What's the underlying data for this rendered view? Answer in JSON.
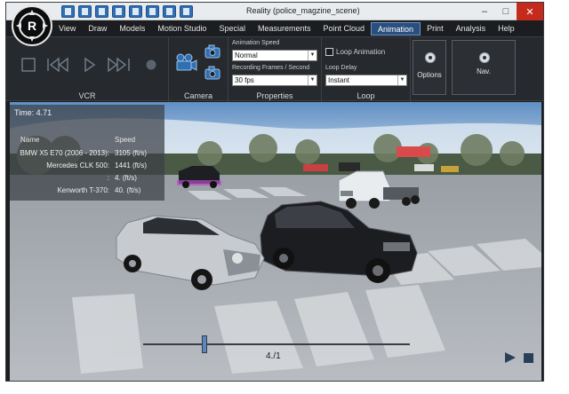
{
  "window": {
    "title": "Reality (police_magzine_scene)",
    "controls": {
      "minimize": "–",
      "maximize": "□",
      "close": "✕"
    }
  },
  "quick_access": [
    "new-file-icon",
    "open-folder-icon",
    "save-icon",
    "save-as-icon",
    "copy-icon",
    "paste-icon",
    "image-icon",
    "link-icon"
  ],
  "menu": {
    "items": [
      {
        "label": "View"
      },
      {
        "label": "Draw"
      },
      {
        "label": "Models"
      },
      {
        "label": "Motion Studio"
      },
      {
        "label": "Special"
      },
      {
        "label": "Measurements"
      },
      {
        "label": "Point Cloud"
      },
      {
        "label": "Animation",
        "active": true
      },
      {
        "label": "Print"
      },
      {
        "label": "Analysis"
      },
      {
        "label": "Help"
      }
    ]
  },
  "ribbon": {
    "vcr": {
      "label": "VCR",
      "buttons": [
        "stop-square-icon",
        "rewind-icon",
        "play-icon",
        "fast-forward-icon",
        "record-icon"
      ]
    },
    "camera": {
      "label": "Camera",
      "icons": [
        "movie-camera-icon",
        "camera-icon",
        "camera-small-icon"
      ]
    },
    "properties": {
      "label": "Properties",
      "animation_speed_label": "Animation Speed",
      "animation_speed_value": "Normal",
      "recording_frames_label": "Recording Frames / Second",
      "recording_frames_value": "30 fps"
    },
    "loop": {
      "label": "Loop",
      "loop_animation_label": "Loop Animation",
      "loop_animation_checked": false,
      "loop_delay_label": "Loop Delay",
      "loop_delay_value": "Instant"
    },
    "options_label": "Options",
    "nav_label": "Nav."
  },
  "overlay": {
    "time": "Time: 4.71",
    "headers": {
      "name": "Name",
      "speed": "Speed"
    },
    "rows": [
      {
        "name": "BMW X5 E70 (2006 - 2013):",
        "speed": "3105 (ft/s)"
      },
      {
        "name": "Mercedes CLK 500:",
        "speed": "1441 (ft/s)"
      },
      {
        "name": ":",
        "speed": "4. (ft/s)"
      },
      {
        "name": "Kenworth T-370:",
        "speed": "40. (ft/s)"
      }
    ]
  },
  "timeline": {
    "counter": "4./1",
    "progress": 0.23
  },
  "colors": {
    "accent": "#2a4f7e",
    "ribbon_bg": "#26292d",
    "close_button": "#c42b1c"
  }
}
